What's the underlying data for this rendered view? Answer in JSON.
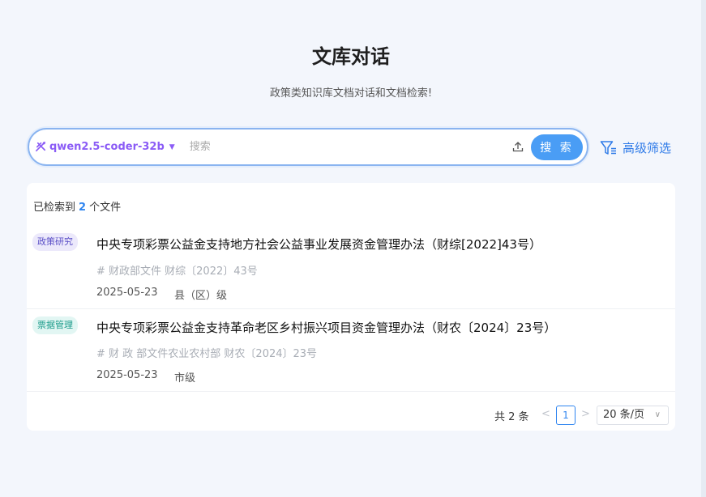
{
  "header": {
    "title": "文库对话",
    "subtitle": "政策类知识库文档对话和文档检索!"
  },
  "search": {
    "model": "qwen2.5-coder-32b",
    "placeholder": "搜索",
    "value": "",
    "button_label": "搜 索",
    "advanced_filter_label": "高级筛选"
  },
  "results": {
    "count_prefix": "已检索到",
    "count": "2",
    "count_suffix": "个文件",
    "items": [
      {
        "tag": "政策研究",
        "title": "中央专项彩票公益金支持地方社会公益事业发展资金管理办法（财综[2022]43号）",
        "tags": "# 财政部文件 财综〔2022〕43号",
        "date": "2025-05-23",
        "level": "县（区）级"
      },
      {
        "tag": "票据管理",
        "title": "中央专项彩票公益金支持革命老区乡村振兴项目资金管理办法（财农〔2024〕23号）",
        "tags": "# 财 政 部文件农业农村部 财农〔2024〕23号",
        "date": "2025-05-23",
        "level": "市级"
      }
    ]
  },
  "pagination": {
    "total": "共 2 条",
    "current_page": "1",
    "page_size": "20 条/页"
  },
  "colors": {
    "accent": "#4a9df5",
    "model_purple": "#8b5cf6",
    "tag1_bg": "#ece9fb",
    "tag1_fg": "#5b4fc7",
    "tag2_bg": "#e2f6f3",
    "tag2_fg": "#1a9b8a"
  }
}
